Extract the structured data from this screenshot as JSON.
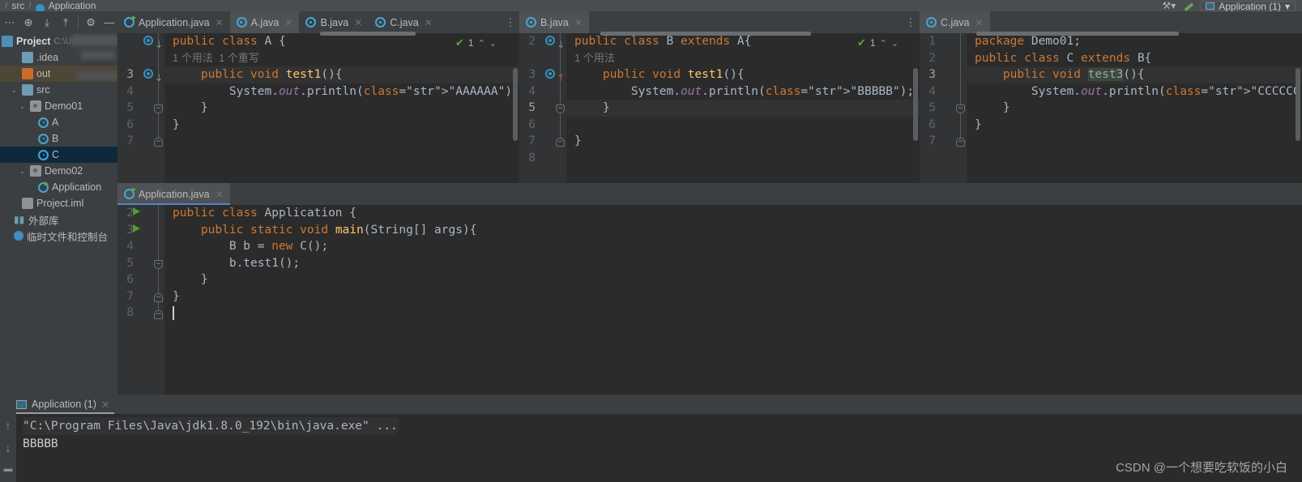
{
  "window": {
    "breadcrumb": [
      "src",
      "Application"
    ],
    "watermark": "CSDN @一个想要吃软饭的小白"
  },
  "topright": {
    "run_config_label": "Application (1)",
    "chevron": "▾",
    "build_icon": "build-icon",
    "hammer_icon": "hammer-icon"
  },
  "toolbar": {
    "items": [
      {
        "name": "more-options-icon",
        "glyph": "⋯"
      },
      {
        "name": "locate-file-icon",
        "glyph": "⊕"
      },
      {
        "name": "expand-all-icon",
        "glyph": "⤓"
      },
      {
        "name": "collapse-all-icon",
        "glyph": "⤒"
      },
      {
        "name": "settings-gear-icon",
        "glyph": "⚙"
      },
      {
        "name": "hide-panel-icon",
        "glyph": "—"
      }
    ]
  },
  "sidebar": {
    "title": "Project",
    "path": "C:\\Us",
    "items": [
      {
        "label": ".idea",
        "icon": "folder-icon",
        "indent": 1,
        "arrow": "",
        "state": ""
      },
      {
        "label": "out",
        "icon": "folder-orange-icon",
        "indent": 1,
        "arrow": "",
        "state": "sel-out"
      },
      {
        "label": "src",
        "icon": "folder-icon",
        "indent": 1,
        "arrow": "⌄",
        "state": ""
      },
      {
        "label": "Demo01",
        "icon": "package-icon",
        "indent": 2,
        "arrow": "⌄",
        "state": ""
      },
      {
        "label": "A",
        "icon": "class-icon",
        "indent": 3,
        "arrow": "",
        "state": ""
      },
      {
        "label": "B",
        "icon": "class-icon",
        "indent": 3,
        "arrow": "",
        "state": ""
      },
      {
        "label": "C",
        "icon": "class-icon",
        "indent": 3,
        "arrow": "",
        "state": "sel-c"
      },
      {
        "label": "Demo02",
        "icon": "package-icon",
        "indent": 2,
        "arrow": "⌄",
        "state": ""
      },
      {
        "label": "Application",
        "icon": "class-runnable-icon",
        "indent": 3,
        "arrow": "",
        "state": ""
      },
      {
        "label": "Project.iml",
        "icon": "iml-file-icon",
        "indent": 1,
        "arrow": "",
        "state": ""
      },
      {
        "label": "外部库",
        "icon": "library-icon",
        "indent": 0,
        "arrow": "",
        "state": ""
      },
      {
        "label": "临时文件和控制台",
        "icon": "scratch-icon",
        "indent": 0,
        "arrow": "",
        "state": ""
      }
    ]
  },
  "editors": [
    {
      "id": "pane-a",
      "tabs": [
        {
          "label": "Application.java",
          "icon": "class-runnable-icon",
          "active": false
        },
        {
          "label": "A.java",
          "icon": "class-icon",
          "active": true
        },
        {
          "label": "B.java",
          "icon": "class-icon",
          "active": false
        },
        {
          "label": "C.java",
          "icon": "class-icon",
          "active": false
        }
      ],
      "tab_more": "⋮",
      "inspection": {
        "count": "1",
        "check": "✔",
        "up": "⌃",
        "down": "⌄"
      },
      "gutter_lines": [
        "",
        "",
        "3",
        "4",
        "5",
        "6",
        "7"
      ],
      "code": [
        "public class A {",
        "1 个用法  1 个重写",
        "    public void test1(){",
        "        System.out.println(\"AAAAAA\");",
        "    }",
        "}",
        ""
      ]
    },
    {
      "id": "pane-b",
      "tabs": [
        {
          "label": "B.java",
          "icon": "class-icon",
          "active": true
        }
      ],
      "tab_more": "⋮",
      "inspection": {
        "count": "1",
        "check": "✔",
        "up": "⌃",
        "down": "⌄"
      },
      "gutter_lines": [
        "2",
        "",
        "3",
        "4",
        "5",
        "6",
        "7",
        "8"
      ],
      "code": [
        "public class B extends A{",
        "1 个用法",
        "    public void test1(){",
        "        System.out.println(\"BBBBB\");",
        "    }",
        "",
        "}",
        ""
      ]
    },
    {
      "id": "pane-c",
      "tabs": [
        {
          "label": "C.java",
          "icon": "class-icon",
          "active": true
        }
      ],
      "tab_more": "",
      "inspection": null,
      "gutter_lines": [
        "1",
        "2",
        "3",
        "4",
        "5",
        "6",
        "7"
      ],
      "code": [
        "package Demo01;",
        "public class C extends B{",
        "    public void test3(){",
        "        System.out.println(\"CCCCCC\")",
        "    }",
        "}",
        ""
      ]
    },
    {
      "id": "pane-main",
      "tabs": [
        {
          "label": "Application.java",
          "icon": "class-runnable-icon",
          "active": true
        }
      ],
      "tab_more": "",
      "inspection": null,
      "gutter_lines": [
        "2",
        "3",
        "4",
        "5",
        "6",
        "7",
        "8"
      ],
      "code": [
        "public class Application {",
        "    public static void main(String[] args){",
        "        B b = new C();",
        "        b.test1();",
        "    }",
        "}",
        ""
      ]
    }
  ],
  "console": {
    "tab_label": "Application (1)",
    "tab_close": "✕",
    "side_icons": [
      {
        "name": "scroll-up-icon",
        "glyph": "↑"
      },
      {
        "name": "scroll-down-icon",
        "glyph": "↓"
      },
      {
        "name": "soft-wrap-icon",
        "glyph": "▬"
      }
    ],
    "lines": [
      "\"C:\\Program Files\\Java\\jdk1.8.0_192\\bin\\java.exe\" ...",
      "BBBBB"
    ]
  }
}
